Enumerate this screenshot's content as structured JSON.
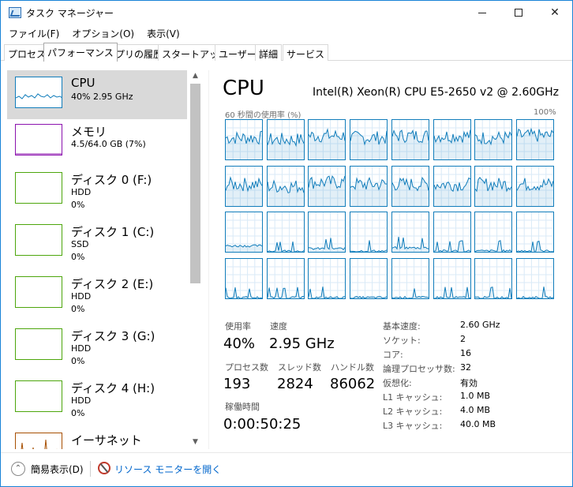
{
  "window": {
    "title": "タスク マネージャー"
  },
  "menu": [
    "ファイル(F)",
    "オプション(O)",
    "表示(V)"
  ],
  "tabs": [
    "プロセス",
    "パフォーマンス",
    "アプリの履歴",
    "スタートアップ",
    "ユーザー",
    "詳細",
    "サービス"
  ],
  "active_tab": "パフォーマンス",
  "sidebar": {
    "items": [
      {
        "title": "CPU",
        "sub": "40%  2.95 GHz",
        "sub2": "",
        "kind": "cpu"
      },
      {
        "title": "メモリ",
        "sub": "4.5/64.0 GB (7%)",
        "sub2": "",
        "kind": "mem"
      },
      {
        "title": "ディスク 0 (F:)",
        "sub": "HDD",
        "sub2": "0%",
        "kind": "disk"
      },
      {
        "title": "ディスク 1 (C:)",
        "sub": "SSD",
        "sub2": "0%",
        "kind": "disk"
      },
      {
        "title": "ディスク 2 (E:)",
        "sub": "HDD",
        "sub2": "0%",
        "kind": "disk"
      },
      {
        "title": "ディスク 3 (G:)",
        "sub": "HDD",
        "sub2": "0%",
        "kind": "disk"
      },
      {
        "title": "ディスク 4 (H:)",
        "sub": "HDD",
        "sub2": "0%",
        "kind": "disk"
      },
      {
        "title": "イーサネット",
        "sub": "",
        "sub2": "",
        "kind": "eth"
      }
    ]
  },
  "main": {
    "title": "CPU",
    "model": "Intel(R) Xeon(R) CPU E5-2650 v2 @ 2.60GHz",
    "graph_label": "60 秒間の使用率 (%)",
    "graph_max": "100%",
    "core_loads": [
      0.55,
      0.5,
      0.6,
      0.55,
      0.6,
      0.6,
      0.55,
      0.6,
      0.55,
      0.5,
      0.6,
      0.55,
      0.55,
      0.55,
      0.55,
      0.55,
      0.15,
      0.02,
      0.08,
      0.02,
      0.1,
      0.02,
      0.02,
      0.02,
      0.02,
      0.02,
      0.02,
      0.02,
      0.02,
      0.02,
      0.02,
      0.02
    ],
    "stats": {
      "utilization_label": "使用率",
      "utilization": "40%",
      "speed_label": "速度",
      "speed": "2.95 GHz",
      "processes_label": "プロセス数",
      "processes": "193",
      "threads_label": "スレッド数",
      "threads": "2824",
      "handles_label": "ハンドル数",
      "handles": "86062",
      "uptime_label": "稼働時間",
      "uptime": "0:00:50:25"
    },
    "details": [
      {
        "label": "基本速度:",
        "value": "2.60 GHz"
      },
      {
        "label": "ソケット:",
        "value": "2"
      },
      {
        "label": "コア:",
        "value": "16"
      },
      {
        "label": "論理プロセッサ数:",
        "value": "32"
      },
      {
        "label": "仮想化:",
        "value": "有効"
      },
      {
        "label": "L1 キャッシュ:",
        "value": "1.0 MB"
      },
      {
        "label": "L2 キャッシュ:",
        "value": "4.0 MB"
      },
      {
        "label": "L3 キャッシュ:",
        "value": "40.0 MB"
      }
    ]
  },
  "footer": {
    "less_label": "簡易表示(D)",
    "monitor_label": "リソース モニターを開く"
  },
  "colors": {
    "cpu": "#117dbb",
    "memory": "#8b12ae",
    "disk": "#4da60c",
    "ethernet": "#a74f01"
  }
}
